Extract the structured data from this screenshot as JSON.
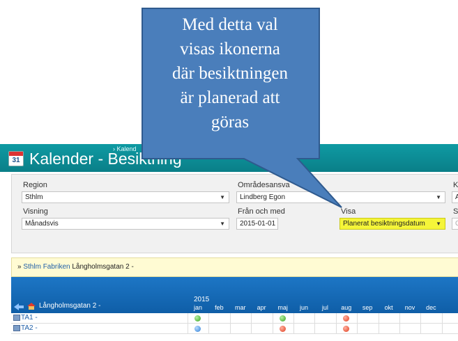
{
  "header": {
    "breadcrumb": "› Kalend",
    "icon_day": "31",
    "title": "Kalender - Besiktning",
    "background": "#0b8c95"
  },
  "filters": {
    "region": {
      "label": "Region",
      "value": "Sthlm"
    },
    "omrade": {
      "label": "Områdesansva",
      "value": "Lindberg Egon"
    },
    "third_partial": {
      "label": "K",
      "value": "A"
    },
    "visning": {
      "label": "Visning",
      "value": "Månadsvis"
    },
    "fran": {
      "label": "Från och med",
      "value": "2015-01-01"
    },
    "visa": {
      "label": "Visa",
      "value": "Planerat besiktningsdatum",
      "highlight_color": "#f5f539"
    },
    "fourth_partial": {
      "label": "S",
      "placeholder": "O"
    }
  },
  "info_bar": {
    "prefix": "»",
    "link1": "Sthlm",
    "link2": "Fabriken",
    "text": "Långholmsgatan 2 -"
  },
  "grid": {
    "header_label": "Långholmsgatan 2 -",
    "year": "2015",
    "months": [
      "jan",
      "feb",
      "mar",
      "apr",
      "maj",
      "jun",
      "jul",
      "aug",
      "sep",
      "okt",
      "nov",
      "dec"
    ],
    "rows": [
      {
        "label": "TA1 -",
        "marks": [
          {
            "month": "jan",
            "status": "green"
          },
          {
            "month": "maj",
            "status": "green"
          },
          {
            "month": "aug",
            "status": "red"
          }
        ]
      },
      {
        "label": "TA2 -",
        "marks": [
          {
            "month": "jan",
            "status": "blue"
          },
          {
            "month": "maj",
            "status": "red"
          },
          {
            "month": "aug",
            "status": "red"
          }
        ]
      }
    ],
    "colors": {
      "header": "#1565b0",
      "green": "#36a31e",
      "red": "#e03c1d",
      "blue": "#2f7fd6"
    }
  },
  "callout": {
    "lines": [
      "Med detta val",
      "visas ikonerna",
      "där besiktningen",
      "är planerad att",
      "göras"
    ],
    "fill": "#4a7ebb"
  }
}
